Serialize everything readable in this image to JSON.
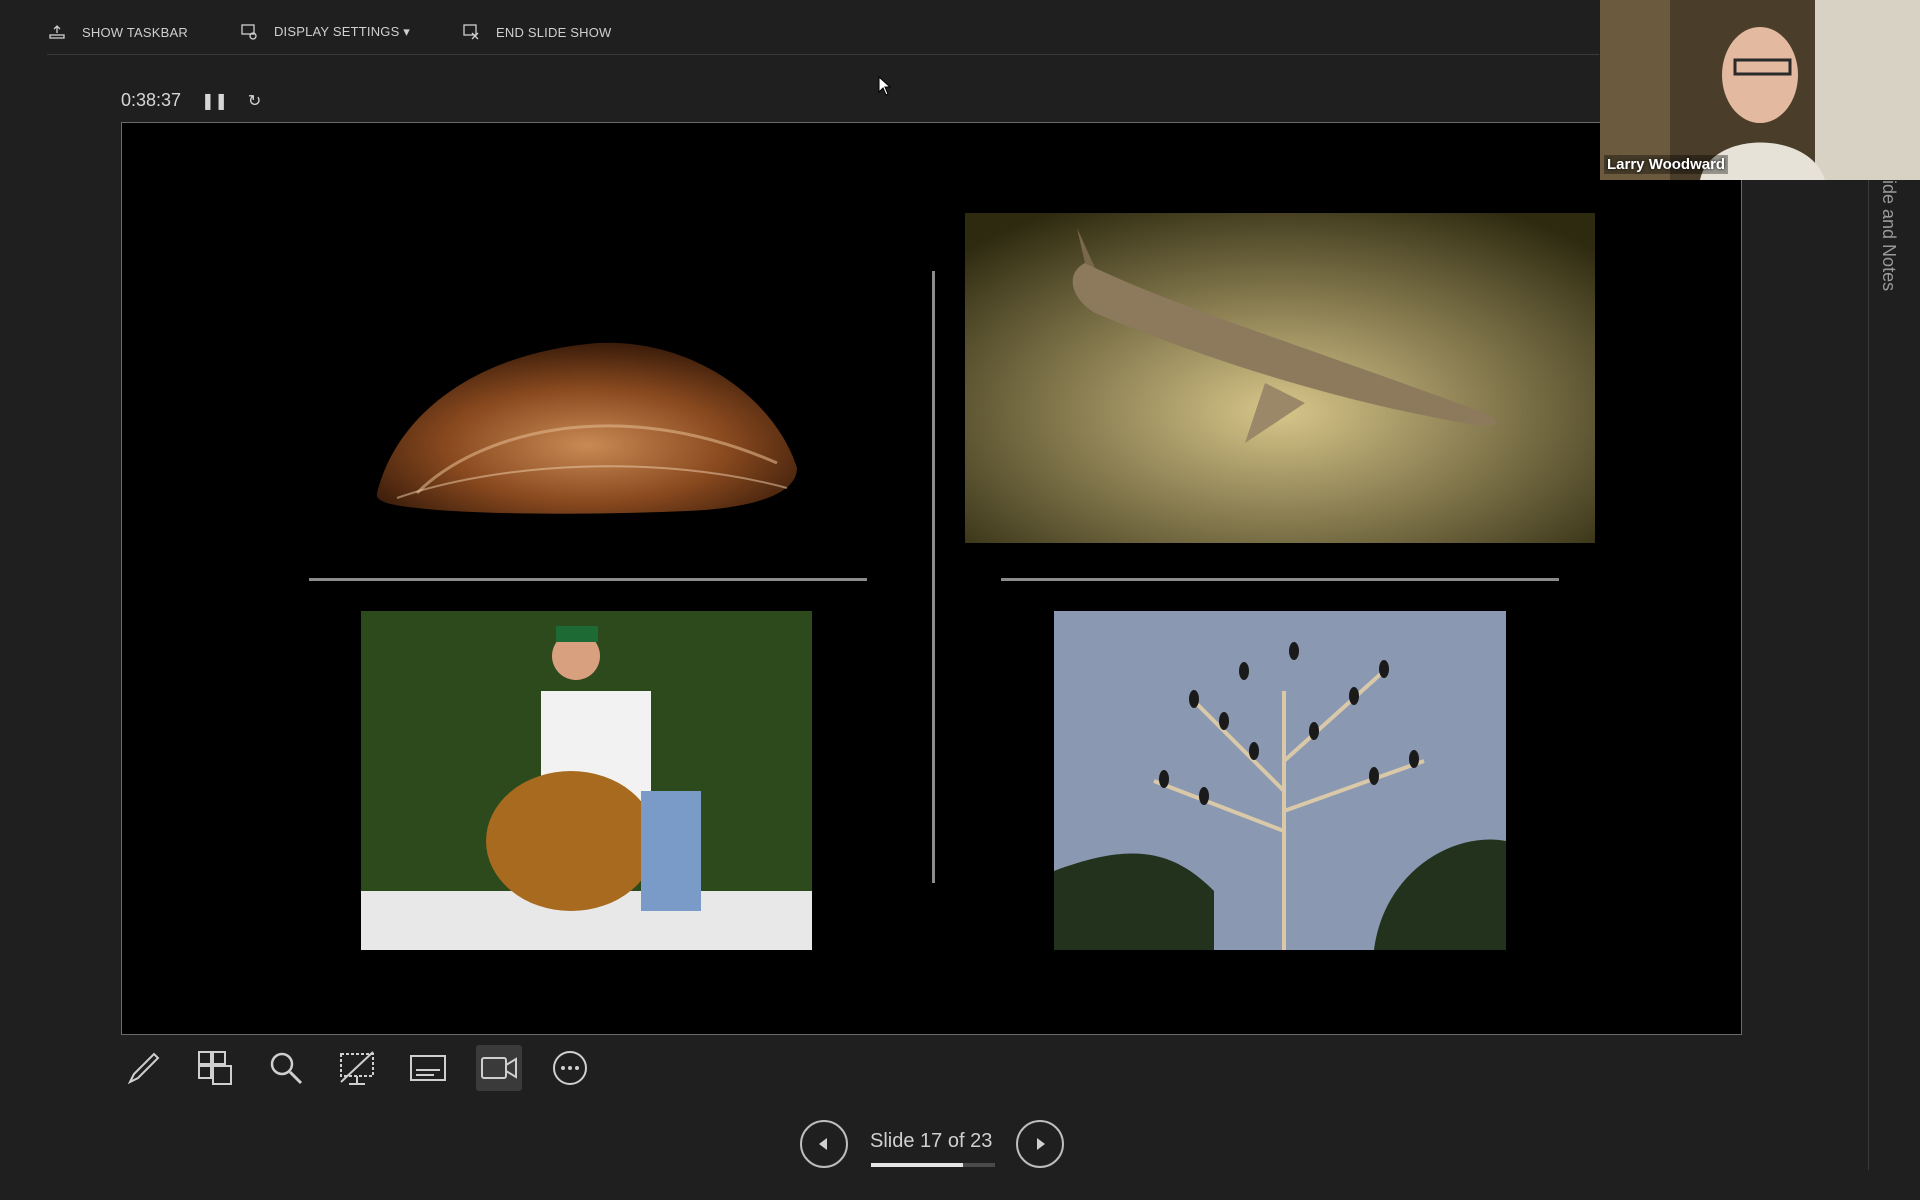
{
  "topbar": {
    "items": [
      {
        "label": "SHOW TASKBAR",
        "icon": "taskbar-icon"
      },
      {
        "label": "DISPLAY SETTINGS ▾",
        "icon": "display-settings-icon"
      },
      {
        "label": "END SLIDE SHOW",
        "icon": "end-show-icon"
      }
    ]
  },
  "presenter": {
    "timer": "0:38:37",
    "pause_icon": "pause-icon",
    "restart_icon": "restart-icon"
  },
  "slide": {
    "photos": [
      {
        "subject": "freshwater-mussel-shell"
      },
      {
        "subject": "sturgeon-fish"
      },
      {
        "subject": "person-with-snapping-turtle"
      },
      {
        "subject": "birds-on-bare-tree"
      }
    ]
  },
  "webcam": {
    "participant_name": "Larry Woodward"
  },
  "side_panel": {
    "label": "ide and Notes"
  },
  "toolbar": {
    "tools": [
      "pen-icon",
      "all-slides-icon",
      "zoom-icon",
      "black-screen-icon",
      "subtitles-icon",
      "camera-icon",
      "more-options-icon"
    ],
    "active_tool": "camera-icon"
  },
  "navigation": {
    "slide_label": "Slide 17 of 23",
    "current": 17,
    "total": 23,
    "progress_fraction": 0.7391
  },
  "colors": {
    "background": "#1f1f1f",
    "slide_background": "#000000",
    "text": "#cfcfcf"
  }
}
